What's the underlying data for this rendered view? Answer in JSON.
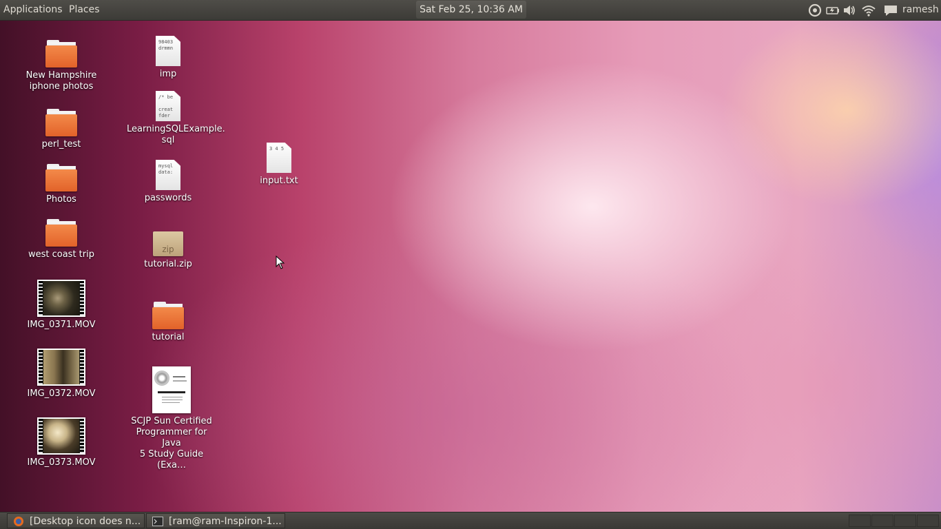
{
  "top_panel": {
    "menus": [
      "Applications",
      "Places"
    ],
    "clock": "Sat Feb 25, 10:36 AM",
    "tray_icons": [
      "ubuntu-update-icon",
      "battery-icon",
      "volume-icon",
      "wifi-icon",
      "messaging-icon"
    ],
    "user": "ramesh"
  },
  "desktop": {
    "column1": [
      {
        "label": "New Hampshire\niphone photos",
        "kind": "folder"
      },
      {
        "label": "perl_test",
        "kind": "folder"
      },
      {
        "label": "Photos",
        "kind": "folder"
      },
      {
        "label": "west coast trip",
        "kind": "folder"
      },
      {
        "label": "IMG_0371.MOV",
        "kind": "video"
      },
      {
        "label": "IMG_0372.MOV",
        "kind": "video"
      },
      {
        "label": "IMG_0373.MOV",
        "kind": "video"
      }
    ],
    "column2": [
      {
        "label": "imp",
        "kind": "text",
        "snippet": "98403\ndrmmn"
      },
      {
        "label": "LearningSQLExample.\nsql",
        "kind": "text",
        "snippet": "/* be\n\ncreat\nfder"
      },
      {
        "label": "passwords",
        "kind": "text",
        "snippet": "mysql\ndata:"
      },
      {
        "label": "tutorial.zip",
        "kind": "zip",
        "zip_text": "zip"
      },
      {
        "label": "tutorial",
        "kind": "folder"
      },
      {
        "label": "SCJP Sun Certified\nProgrammer for Java\n5 Study Guide (Exa…",
        "kind": "pdf"
      }
    ],
    "loose": [
      {
        "label": "input.txt",
        "kind": "text",
        "snippet": "3 4 5"
      }
    ]
  },
  "bottom_panel": {
    "tasks": [
      {
        "label": "[Desktop icon does n...",
        "icon": "firefox-icon"
      },
      {
        "label": "[ram@ram-Inspiron-1...",
        "icon": "terminal-icon"
      }
    ],
    "workspaces": 4
  }
}
